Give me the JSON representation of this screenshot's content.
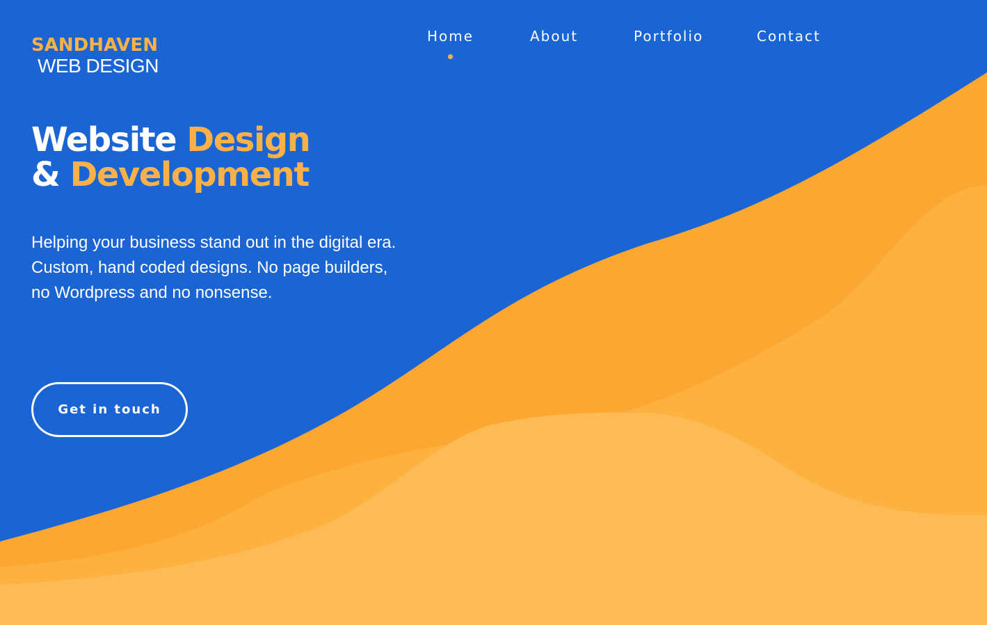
{
  "brand": {
    "name_line1": "SANDHAVEN",
    "name_line2": "WEB DESIGN"
  },
  "nav": {
    "active": "Home",
    "items": [
      {
        "label": "Home"
      },
      {
        "label": "About"
      },
      {
        "label": "Portfolio"
      },
      {
        "label": "Contact"
      }
    ]
  },
  "hero": {
    "title_part1": "Website ",
    "title_accent1": "Design",
    "title_part2": "& ",
    "title_accent2": "Development",
    "description": "Helping your business stand out in the digital era. Custom, hand coded designs. No page builders, no Wordpress and no nonsense.",
    "cta_label": "Get in touch"
  },
  "colors": {
    "background": "#1b64d4",
    "accent": "#fbb148",
    "wave_dark": "#fca731",
    "wave_mid": "#fdb23f",
    "wave_light": "#fdbb55",
    "text": "#ffffff"
  }
}
